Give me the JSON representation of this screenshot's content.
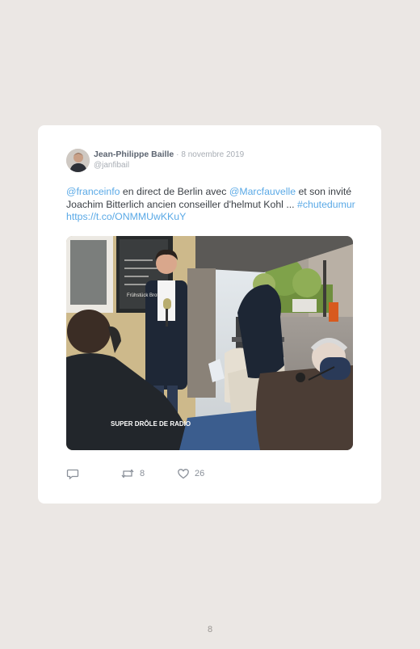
{
  "tweet": {
    "author_name": "Jean-Philippe Baille",
    "separator": "·",
    "date": "8 novembre 2019",
    "handle": "@janfibail",
    "text_segments": [
      {
        "text": "@franceinfo",
        "link": true
      },
      {
        "text": " en direct de Berlin avec ",
        "link": false
      },
      {
        "text": "@Marcfauvelle",
        "link": true
      },
      {
        "text": " et son invité Joachim Bitterlich ancien conseiller d'helmut Kohl ... ",
        "link": false
      },
      {
        "text": "#chutedumur",
        "link": true
      },
      {
        "text": " ",
        "link": false
      },
      {
        "text": "https://t.co/ONMMUwKKuY",
        "link": true
      }
    ],
    "photo": {
      "mic_logo_text": "SUPER DRÔLE DE RADIO",
      "window_text": "Frühstück Brot"
    },
    "actions": {
      "reply_count": "",
      "retweet_count": "8",
      "like_count": "26"
    }
  },
  "colors": {
    "page_background": "#ebe7e4",
    "card_background": "#ffffff",
    "link": "#5aa9e6",
    "muted": "#a8adb4"
  },
  "page_number": "8"
}
